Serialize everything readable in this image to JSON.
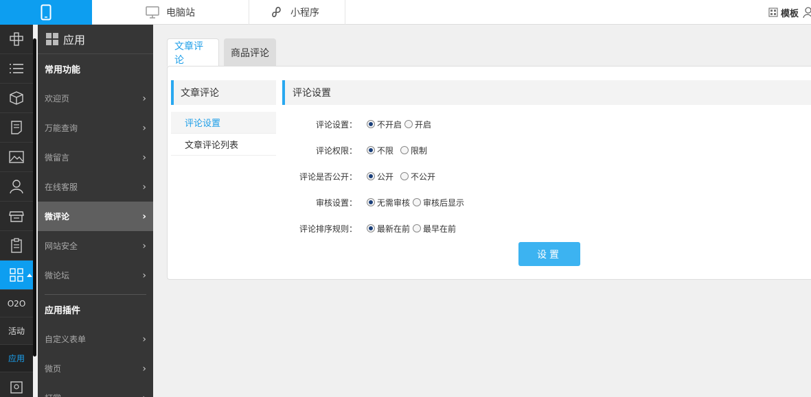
{
  "topbar": {
    "pc_label": "电脑站",
    "mini_label": "小程序",
    "template_label": "模板"
  },
  "rail": {
    "texts": [
      "O2O",
      "活动",
      "应用"
    ]
  },
  "submenu": {
    "header": "应用",
    "section1": "常用功能",
    "items": [
      "欢迎页",
      "万能查询",
      "微留言",
      "在线客服",
      "微评论",
      "网站安全",
      "微论坛"
    ],
    "section2": "应用插件",
    "items2": [
      "自定义表单",
      "微页",
      "打赏"
    ]
  },
  "tabs": [
    "文章评论",
    "商品评论"
  ],
  "leftnav": {
    "title": "文章评论",
    "items": [
      "评论设置",
      "文章评论列表"
    ]
  },
  "form": {
    "title": "评论设置",
    "rows": [
      {
        "label": "评论设置：",
        "opt1": "不开启",
        "opt2": "开启"
      },
      {
        "label": "评论权限：",
        "opt1": "不限",
        "opt2": "限制"
      },
      {
        "label": "评论是否公开：",
        "opt1": "公开",
        "opt2": "不公开"
      },
      {
        "label": "审核设置：",
        "opt1": "无需审核",
        "opt2": "审核后显示"
      },
      {
        "label": "评论排序规则：",
        "opt1": "最新在前",
        "opt2": "最早在前"
      }
    ],
    "submit": "设置"
  },
  "colors": {
    "accent": "#0d9ef0",
    "button": "#3cb3f1"
  }
}
